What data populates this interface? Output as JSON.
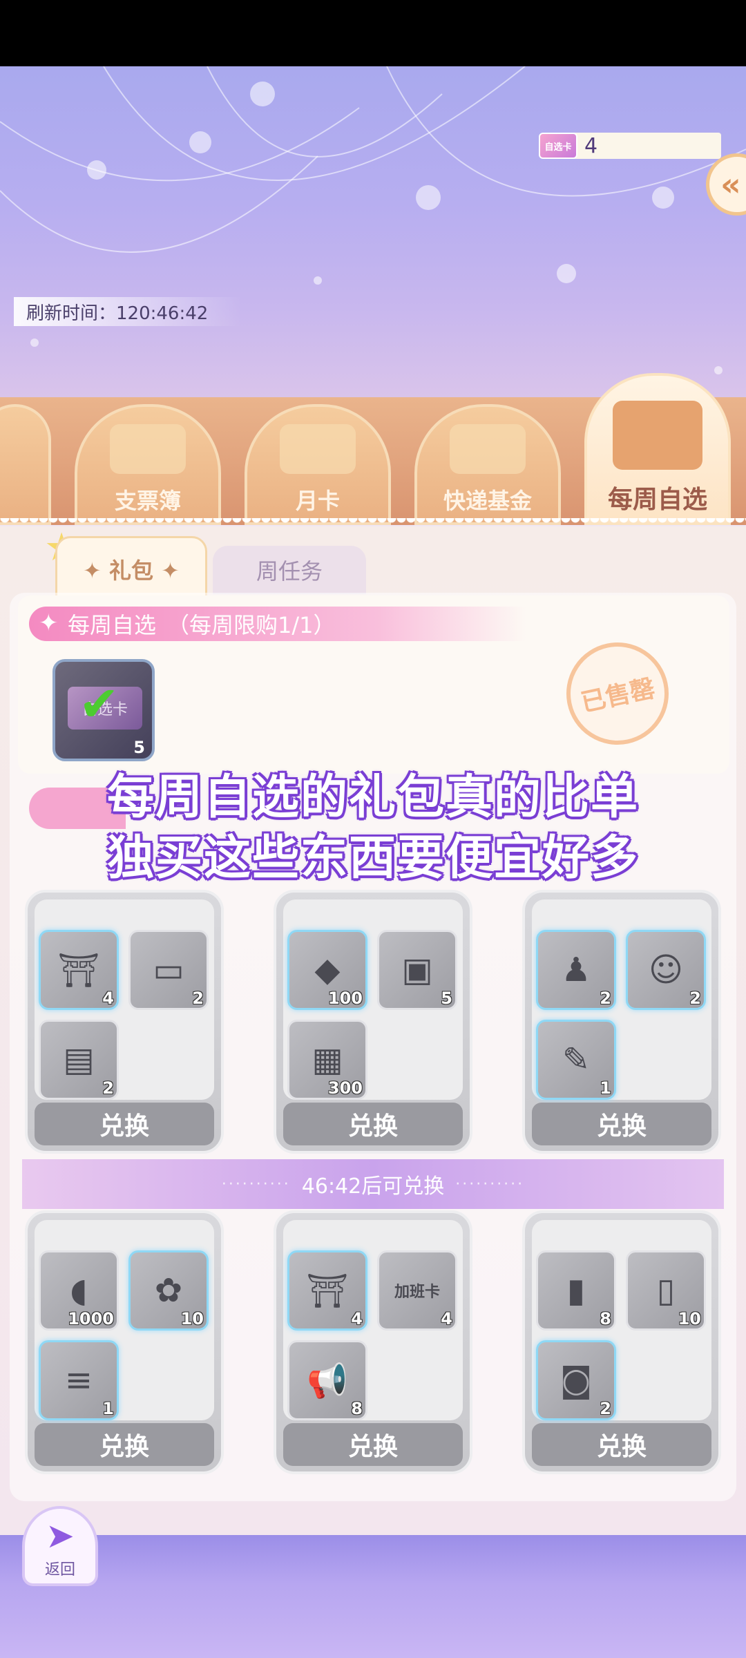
{
  "voucher": {
    "icon_label": "自选卡",
    "count": "4"
  },
  "collapse_icon": "double-chevron-left-icon",
  "refresh": {
    "text": "刷新时间：120:46:42"
  },
  "shop_tabs": [
    {
      "label": "支票簿",
      "icon": "checkbook-icon"
    },
    {
      "label": "月卡",
      "icon": "card-icon"
    },
    {
      "label": "快递基金",
      "icon": "gift-box-icon"
    },
    {
      "label": "每周自选",
      "icon": "open-box-icon"
    }
  ],
  "sub_tabs": {
    "gift": "✦ 礼包 ✦",
    "weekly_task": "周任务"
  },
  "weekly": {
    "title": "每周自选　（每周限购1/1）",
    "item_card_text": "自选卡",
    "item_count": "5",
    "sold_out": "已售罄"
  },
  "overlay_caption": {
    "line1": "每周自选的礼包真的比单",
    "line2": "独买这些东西要便宜好多"
  },
  "timer_text": "46:42后可兑换",
  "bundles": [
    {
      "redeem": "兑换",
      "items": [
        {
          "icon": "charm-tag-icon",
          "glyph": "⛩",
          "count": "4",
          "glow": true
        },
        {
          "icon": "license-card-icon",
          "glyph": "▭",
          "count": "2",
          "glow": false
        },
        {
          "icon": "document-icon",
          "glyph": "▤",
          "count": "2",
          "glow": false
        }
      ]
    },
    {
      "redeem": "兑换",
      "items": [
        {
          "icon": "diamond-icon",
          "glyph": "◆",
          "count": "100",
          "glow": true
        },
        {
          "icon": "outfit-card-icon",
          "glyph": "▣",
          "count": "5",
          "glow": false
        },
        {
          "icon": "box-icon",
          "glyph": "▦",
          "count": "300",
          "glow": false
        }
      ]
    },
    {
      "redeem": "兑换",
      "items": [
        {
          "icon": "suit-icon",
          "glyph": "♟",
          "count": "2",
          "glow": true
        },
        {
          "icon": "id-card-icon",
          "glyph": "☺",
          "count": "2",
          "glow": true
        },
        {
          "icon": "notebook-icon",
          "glyph": "✎",
          "count": "1",
          "glow": true
        }
      ]
    },
    {
      "redeem": "兑换",
      "items": [
        {
          "icon": "bone-icon",
          "glyph": "◖",
          "count": "1000",
          "glow": false
        },
        {
          "icon": "paw-tag-icon",
          "glyph": "✿",
          "count": "10",
          "glow": true
        },
        {
          "icon": "comb-icon",
          "glyph": "≡",
          "count": "1",
          "glow": true
        }
      ]
    },
    {
      "redeem": "兑换",
      "items": [
        {
          "icon": "charm-tag-icon",
          "glyph": "⛩",
          "count": "4",
          "glow": true
        },
        {
          "icon": "overtime-card-icon",
          "glyph": "加班卡",
          "count": "4",
          "glow": false
        },
        {
          "icon": "megaphone-ticket-icon",
          "glyph": "📢",
          "count": "8",
          "glow": false
        }
      ]
    },
    {
      "redeem": "兑换",
      "items": [
        {
          "icon": "lipstick-icon",
          "glyph": "▮",
          "count": "8",
          "glow": false
        },
        {
          "icon": "cream-tube-icon",
          "glyph": "▯",
          "count": "10",
          "glow": false
        },
        {
          "icon": "lotion-bottle-icon",
          "glyph": "◙",
          "count": "2",
          "glow": true
        }
      ]
    }
  ],
  "back_button": {
    "label": "返回",
    "icon": "back-arrow-icon"
  }
}
